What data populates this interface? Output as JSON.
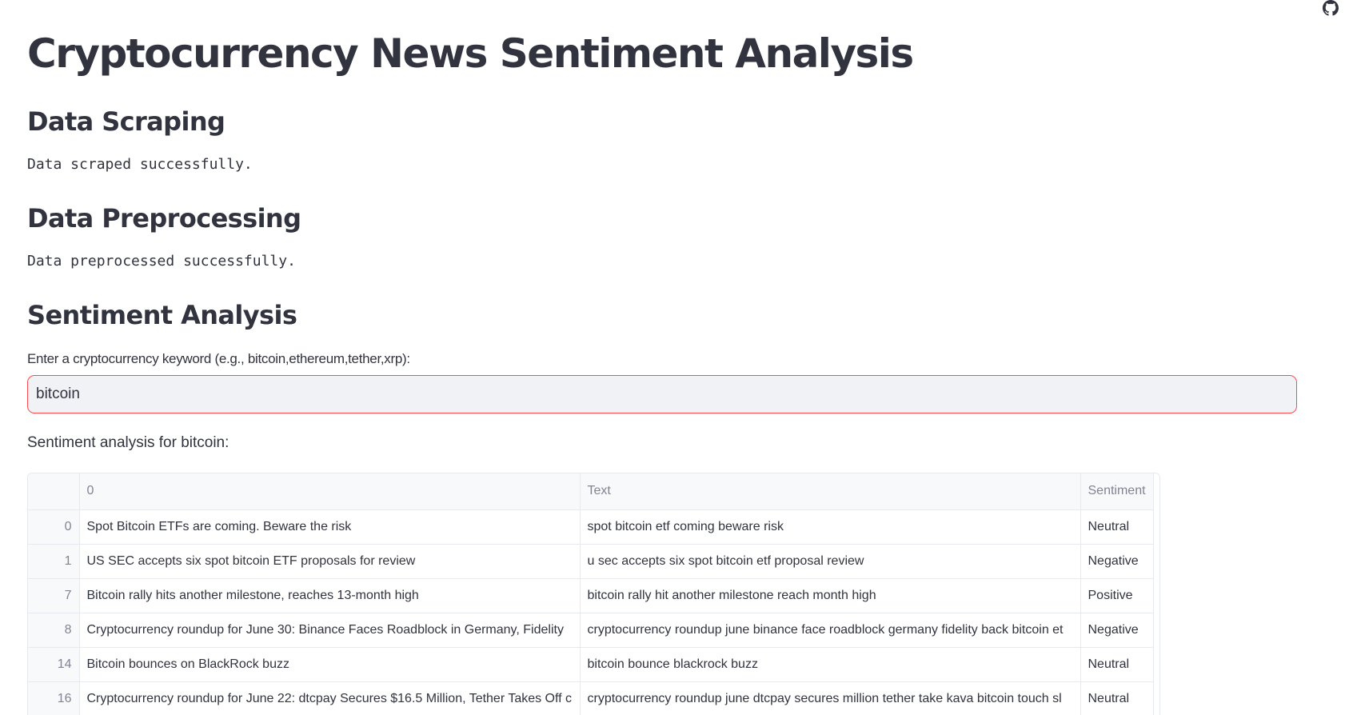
{
  "app": {
    "title": "Cryptocurrency News Sentiment Analysis",
    "github_icon": "github-icon"
  },
  "sections": {
    "scraping": {
      "heading": "Data Scraping",
      "status": "Data scraped successfully."
    },
    "preprocessing": {
      "heading": "Data Preprocessing",
      "status": "Data preprocessed successfully."
    },
    "sentiment": {
      "heading": "Sentiment Analysis",
      "input_label": "Enter a cryptocurrency keyword (e.g., bitcoin,ethereum,tether,xrp):",
      "input_value": "bitcoin",
      "result_label": "Sentiment analysis for bitcoin:"
    }
  },
  "table": {
    "columns": [
      "",
      "0",
      "Text",
      "Sentiment"
    ],
    "rows": [
      {
        "index": "0",
        "title": "Spot Bitcoin ETFs are coming. Beware the risk",
        "text": "spot bitcoin etf coming beware risk",
        "sentiment": "Neutral"
      },
      {
        "index": "1",
        "title": "US SEC accepts six spot bitcoin ETF proposals for review",
        "text": "u sec accepts six spot bitcoin etf proposal review",
        "sentiment": "Negative"
      },
      {
        "index": "7",
        "title": "Bitcoin rally hits another milestone, reaches 13-month high",
        "text": "bitcoin rally hit another milestone reach month high",
        "sentiment": "Positive"
      },
      {
        "index": "8",
        "title": "Cryptocurrency roundup for June 30: Binance Faces Roadblock in Germany, Fidelity",
        "text": "cryptocurrency roundup june binance face roadblock germany fidelity back bitcoin et",
        "sentiment": "Negative"
      },
      {
        "index": "14",
        "title": "Bitcoin bounces on BlackRock buzz",
        "text": "bitcoin bounce blackrock buzz",
        "sentiment": "Neutral"
      },
      {
        "index": "16",
        "title": "Cryptocurrency roundup for June 22: dtcpay Secures $16.5 Million, Tether Takes Off c",
        "text": "cryptocurrency roundup june dtcpay secures million tether take kava bitcoin touch sl",
        "sentiment": "Neutral"
      }
    ]
  },
  "colors": {
    "accent": "#ff4b4b",
    "text": "#31333f",
    "muted": "#808495",
    "input_bg": "#f0f2f6",
    "table_header_bg": "#f8f9fb",
    "border": "#e6e9ef"
  }
}
